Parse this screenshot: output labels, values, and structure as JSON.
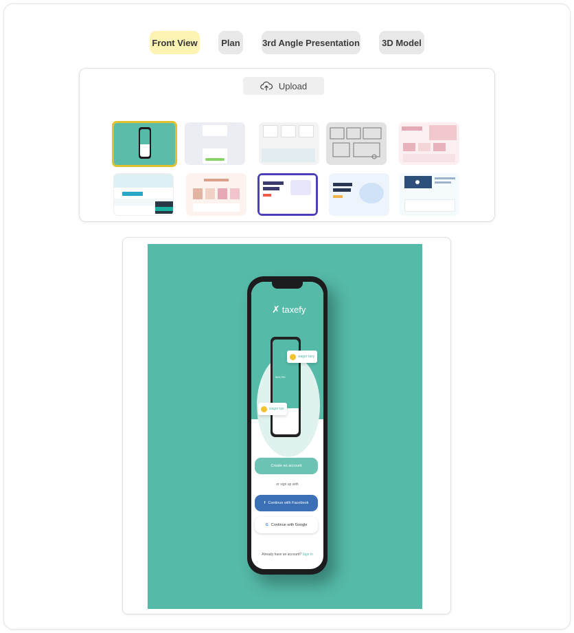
{
  "tabs": [
    {
      "label": "Front View",
      "active": true
    },
    {
      "label": "Plan",
      "active": false
    },
    {
      "label": "3rd Angle Presentation",
      "active": false
    },
    {
      "label": "3D Model",
      "active": false
    }
  ],
  "gallery": {
    "upload_label": "Upload",
    "thumbnails": [
      {
        "name": "taxefy-phone-mockup",
        "selected": true
      },
      {
        "name": "mobile-app-screens",
        "selected": false
      },
      {
        "name": "wireframe-collage",
        "selected": false
      },
      {
        "name": "grey-wireframe-sketch",
        "selected": false
      },
      {
        "name": "fashion-landing-page",
        "selected": false
      },
      {
        "name": "health-insurance-site",
        "selected": false
      },
      {
        "name": "product-showcase-page",
        "selected": false
      },
      {
        "name": "purple-business-site",
        "selected": false
      },
      {
        "name": "team-illustration-landing",
        "selected": false
      },
      {
        "name": "blue-video-landing",
        "selected": false
      }
    ]
  },
  "preview": {
    "app_logo": "taxefy",
    "chip_top": "wager taxy",
    "chip_bottom": "wager tax",
    "mini_amount": "$18,700",
    "create_account": "Create an account",
    "or_sign_up": "or sign up with",
    "facebook_button": "Continue with Facebook",
    "google_button": "Continue with Google",
    "have_account": "Already have an account?",
    "sign_in": "Sign in"
  },
  "colors": {
    "accent_yellow": "#fdf4b3",
    "selected_border": "#e4c12c",
    "teal": "#56baa8",
    "facebook_blue": "#3b6fb6"
  }
}
